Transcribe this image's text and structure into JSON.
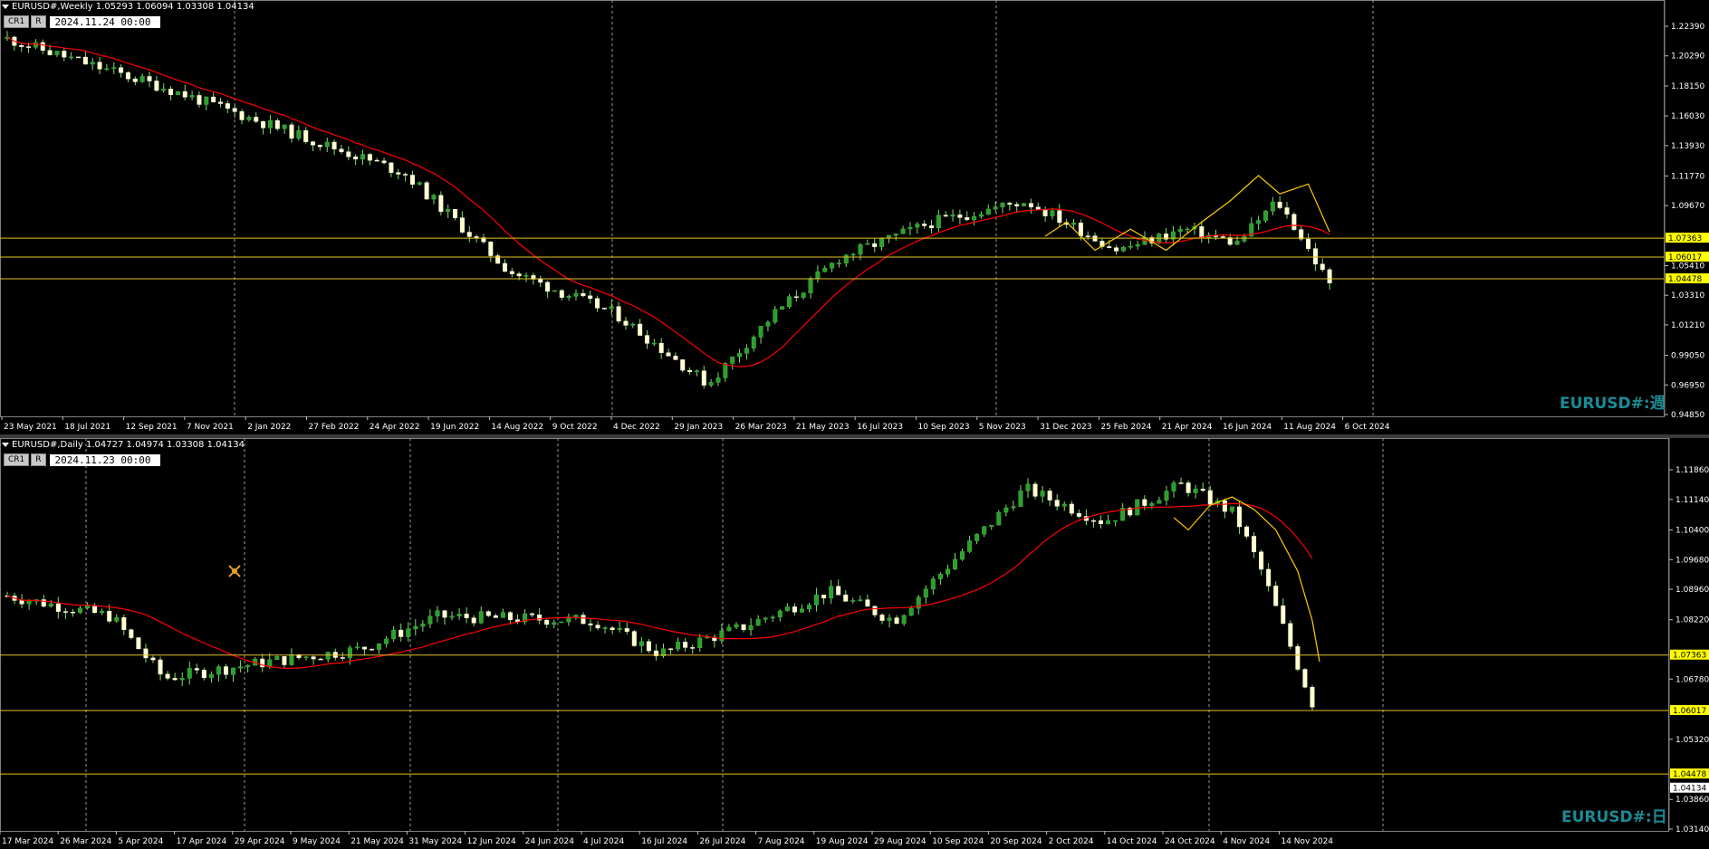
{
  "top": {
    "header": "EURUSD#,Weekly  1.05293 1.06094 1.03308 1.04134",
    "btn_cr": "CR1",
    "btn_r": "R",
    "date": "2024.11.24 00:00",
    "watermark": "EURUSD#:週",
    "price_labels": [
      "1.22390",
      "1.20290",
      "1.18150",
      "1.16030",
      "1.13930",
      "1.11770",
      "1.09670",
      "1.07363",
      "1.06017",
      "1.05410",
      "1.04478",
      "1.03310",
      "1.01210",
      "0.99050",
      "0.96950",
      "0.94850"
    ],
    "time_labels": [
      "23 May 2021",
      "18 Jul 2021",
      "12 Sep 2021",
      "7 Nov 2021",
      "2 Jan 2022",
      "27 Feb 2022",
      "24 Apr 2022",
      "19 Jun 2022",
      "14 Aug 2022",
      "9 Oct 2022",
      "4 Dec 2022",
      "29 Jan 2023",
      "26 Mar 2023",
      "21 May 2023",
      "16 Jul 2023",
      "10 Sep 2023",
      "5 Nov 2023",
      "31 Dec 2023",
      "25 Feb 2024",
      "21 Apr 2024",
      "16 Jun 2024",
      "11 Aug 2024",
      "6 Oct 2024"
    ],
    "hlines": [
      "1.07363",
      "1.06017",
      "1.04478"
    ],
    "ma_color": "#ff0000",
    "zigzag_color": "#ffff00"
  },
  "bottom": {
    "header": "EURUSD#,Daily  1.04727 1.04974 1.03308 1.04134",
    "btn_cr": "CR1",
    "btn_r": "R",
    "date": "2024.11.23 00:00",
    "watermark": "EURUSD#:日",
    "price_labels": [
      "1.11860",
      "1.11140",
      "1.10400",
      "1.09680",
      "1.08960",
      "1.08220",
      "1.07363",
      "1.06780",
      "1.06017",
      "1.05320",
      "1.04478",
      "1.04134",
      "1.03860",
      "1.03140"
    ],
    "time_labels": [
      "17 Mar 2024",
      "26 Mar 2024",
      "5 Apr 2024",
      "17 Apr 2024",
      "29 Apr 2024",
      "9 May 2024",
      "21 May 2024",
      "31 May 2024",
      "12 Jun 2024",
      "24 Jun 2024",
      "4 Jul 2024",
      "16 Jul 2024",
      "26 Jul 2024",
      "7 Aug 2024",
      "19 Aug 2024",
      "29 Aug 2024",
      "10 Sep 2024",
      "20 Sep 2024",
      "2 Oct 2024",
      "14 Oct 2024",
      "24 Oct 2024",
      "4 Nov 2024",
      "14 Nov 2024"
    ],
    "hlines": [
      "1.07363",
      "1.06017",
      "1.04478"
    ],
    "current_price": "1.04134"
  }
}
